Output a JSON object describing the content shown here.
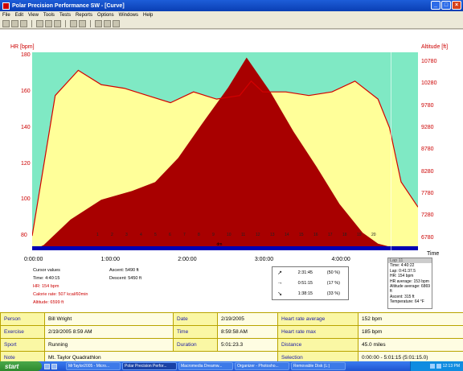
{
  "window": {
    "title": "Polar Precision Performance SW - [Curve]",
    "controls": [
      "_",
      "□",
      "×"
    ]
  },
  "menu": [
    "File",
    "Edit",
    "View",
    "Tools",
    "Tests",
    "Reports",
    "Options",
    "Windows",
    "Help"
  ],
  "toolbar_icons": [
    "open-icon",
    "save-icon",
    "print-icon",
    "zoom-icon",
    "chart-icon",
    "settings-icon",
    "calendar-icon",
    "search-icon",
    "graph-icon",
    "graph2-icon",
    "graph3-icon"
  ],
  "colors": {
    "hr_line": "#d40000",
    "altitude_fill": "#a80000",
    "zone_fill": "#ffff99",
    "background_fill": "#7fe9c4",
    "bottom_band": "#0000b4"
  },
  "chart_data": {
    "type": "area",
    "series": [
      {
        "name": "",
        "kind": "heart_rate",
        "x": [
          0,
          0.3,
          0.6,
          0.9,
          1.2,
          1.5,
          1.8,
          2.1,
          2.4,
          2.7,
          2.85,
          3.0,
          3.3,
          3.6,
          3.9,
          4.2,
          4.5,
          4.65,
          4.8,
          5.02
        ],
        "y": [
          80,
          158,
          172,
          164,
          162,
          158,
          154,
          160,
          156,
          158,
          166,
          160,
          160,
          158,
          160,
          166,
          156,
          140,
          110,
          96
        ]
      },
      {
        "name": "",
        "kind": "altitude",
        "x": [
          0,
          0.15,
          0.5,
          0.9,
          1.3,
          1.6,
          1.9,
          2.2,
          2.55,
          2.79,
          3.1,
          3.4,
          3.7,
          4.0,
          4.3,
          4.5,
          4.7,
          5.02
        ],
        "y": [
          6500,
          6620,
          7200,
          7650,
          7850,
          8050,
          8600,
          9350,
          10200,
          10880,
          10100,
          9200,
          8400,
          7550,
          6900,
          6650,
          6560,
          6560
        ]
      }
    ],
    "xlabel": "Time",
    "x_ticks": [
      "0:00:00",
      "1:00:00",
      "2:00:00",
      "3:00:00",
      "4:00:00"
    ],
    "xlim": [
      0,
      5.02
    ],
    "left_axis": {
      "label": "HR [bpm]",
      "ticks": [
        80,
        100,
        120,
        140,
        160,
        180
      ],
      "range": [
        72,
        182
      ]
    },
    "right_axis": {
      "label": "Altitude [ft]",
      "ticks": [
        6780,
        7280,
        7780,
        8280,
        8780,
        9280,
        9780,
        10280,
        10780
      ],
      "range": [
        6500,
        11000
      ]
    },
    "lap_markers": [
      "1",
      "2",
      "3",
      "4",
      "5",
      "6",
      "7",
      "8",
      "9",
      "10",
      "11",
      "12",
      "13",
      "14",
      "15",
      "16",
      "17",
      "18",
      "19",
      "20"
    ],
    "band_label": "dm",
    "zone_band": [
      120,
      185
    ]
  },
  "cursor": {
    "title": "Cursor values",
    "time": "Time: 4:40:15",
    "hr": "HR: 154 bpm",
    "calorie": "Calorie rate: 507 kcal/60min",
    "altitude": "Altitude: 6599 ft",
    "ascent": "Ascent: 5490 ft",
    "descent": "Descent: 5450 ft"
  },
  "zones": [
    {
      "arrow": "↗",
      "time": "2:31:45",
      "pct": "(50 %)"
    },
    {
      "arrow": "→",
      "time": "0:51:15",
      "pct": "(17 %)"
    },
    {
      "arrow": "↘",
      "time": "1:38:15",
      "pct": "(33 %)"
    }
  ],
  "lap_tooltip": {
    "title": "Lap 11",
    "lines": [
      "Time: 4:40:22",
      "Lap: 0:41:37.5",
      "HR: 154 bpm",
      "HR average: 153 bpm",
      "Altitude average: 6869 ft",
      "Ascent: 315 ft",
      "Temperature: 64 °F"
    ]
  },
  "info": {
    "person_label": "Person",
    "person": "Bill Wright",
    "date_label": "Date",
    "date": "2/19/2005",
    "hravg_label": "Heart rate average",
    "hravg": "152 bpm",
    "exercise_label": "Exercise",
    "exercise": "2/19/2005 8:59 AM",
    "time_label": "Time",
    "time": "8:59:58 AM",
    "hrmax_label": "Heart rate max",
    "hrmax": "185 bpm",
    "sport_label": "Sport",
    "sport": "Running",
    "duration_label": "Duration",
    "duration": "5:01:23.3",
    "distance_label": "Distance",
    "distance": "45.0 miles",
    "note_label": "Note",
    "note": "Mt. Taylor Quadrathlon",
    "selection_label": "Selection",
    "selection": "0:00:00 - 5:01:15 (5:01:15.0)"
  },
  "taskbar": {
    "start": "start",
    "tasks": [
      "MrTaylor2005 - Micro...",
      "Polar Precision Perfor...",
      "Macromedia Dreamw...",
      "Organizer - Photosho...",
      "Removable Disk (L:)"
    ],
    "clock": "12:13 PM"
  }
}
